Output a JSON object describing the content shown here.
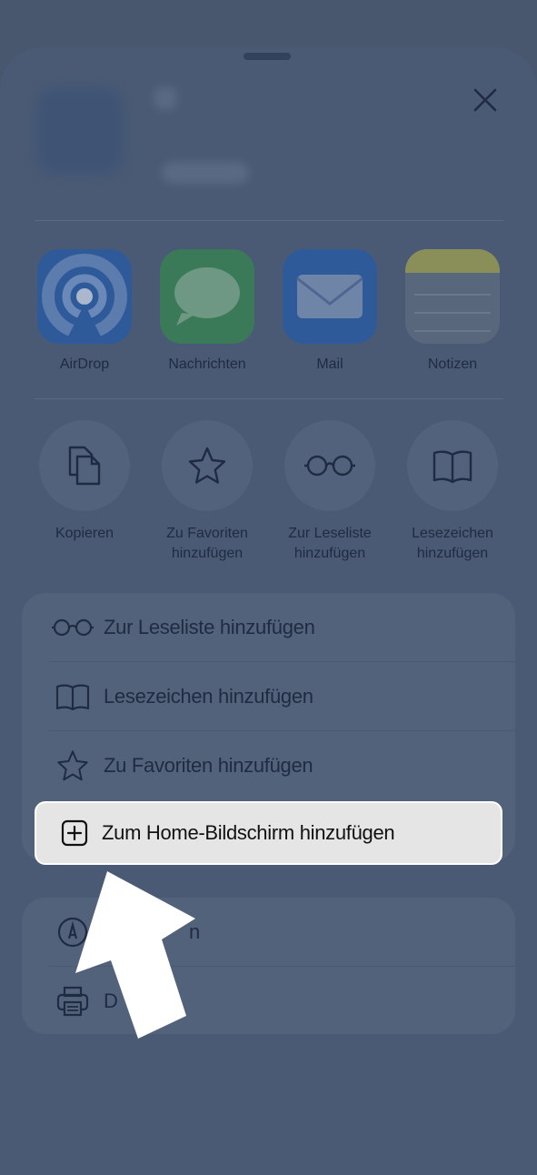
{
  "share_sheet": {
    "apps": [
      {
        "label": "AirDrop",
        "icon": "airdrop-icon"
      },
      {
        "label": "Nachrichten",
        "icon": "messages-icon"
      },
      {
        "label": "Mail",
        "icon": "mail-icon"
      },
      {
        "label": "Notizen",
        "icon": "notes-icon"
      }
    ],
    "actions": [
      {
        "label": "Kopieren",
        "icon": "copy-icon"
      },
      {
        "label": "Zu Favoriten hinzufügen",
        "icon": "star-icon"
      },
      {
        "label": "Zur Leseliste hinzufügen",
        "icon": "glasses-icon"
      },
      {
        "label": "Lesezeichen hinzufügen",
        "icon": "book-icon"
      }
    ],
    "list_group_1": [
      {
        "label": "Zur Leseliste hinzufügen",
        "icon": "glasses-icon"
      },
      {
        "label": "Lesezeichen hinzufügen",
        "icon": "book-icon"
      },
      {
        "label": "Zu Favoriten hinzufügen",
        "icon": "star-icon"
      },
      {
        "label": "Zum Home-Bildschirm hinzufügen",
        "icon": "plus-square-icon"
      }
    ],
    "list_group_2": [
      {
        "label": "n",
        "icon": "markup-icon"
      },
      {
        "label": "D",
        "icon": "print-icon"
      }
    ]
  },
  "colors": {
    "overlay": "#48566e",
    "highlight": "#e5e5e5",
    "arrow": "#ffffff"
  }
}
